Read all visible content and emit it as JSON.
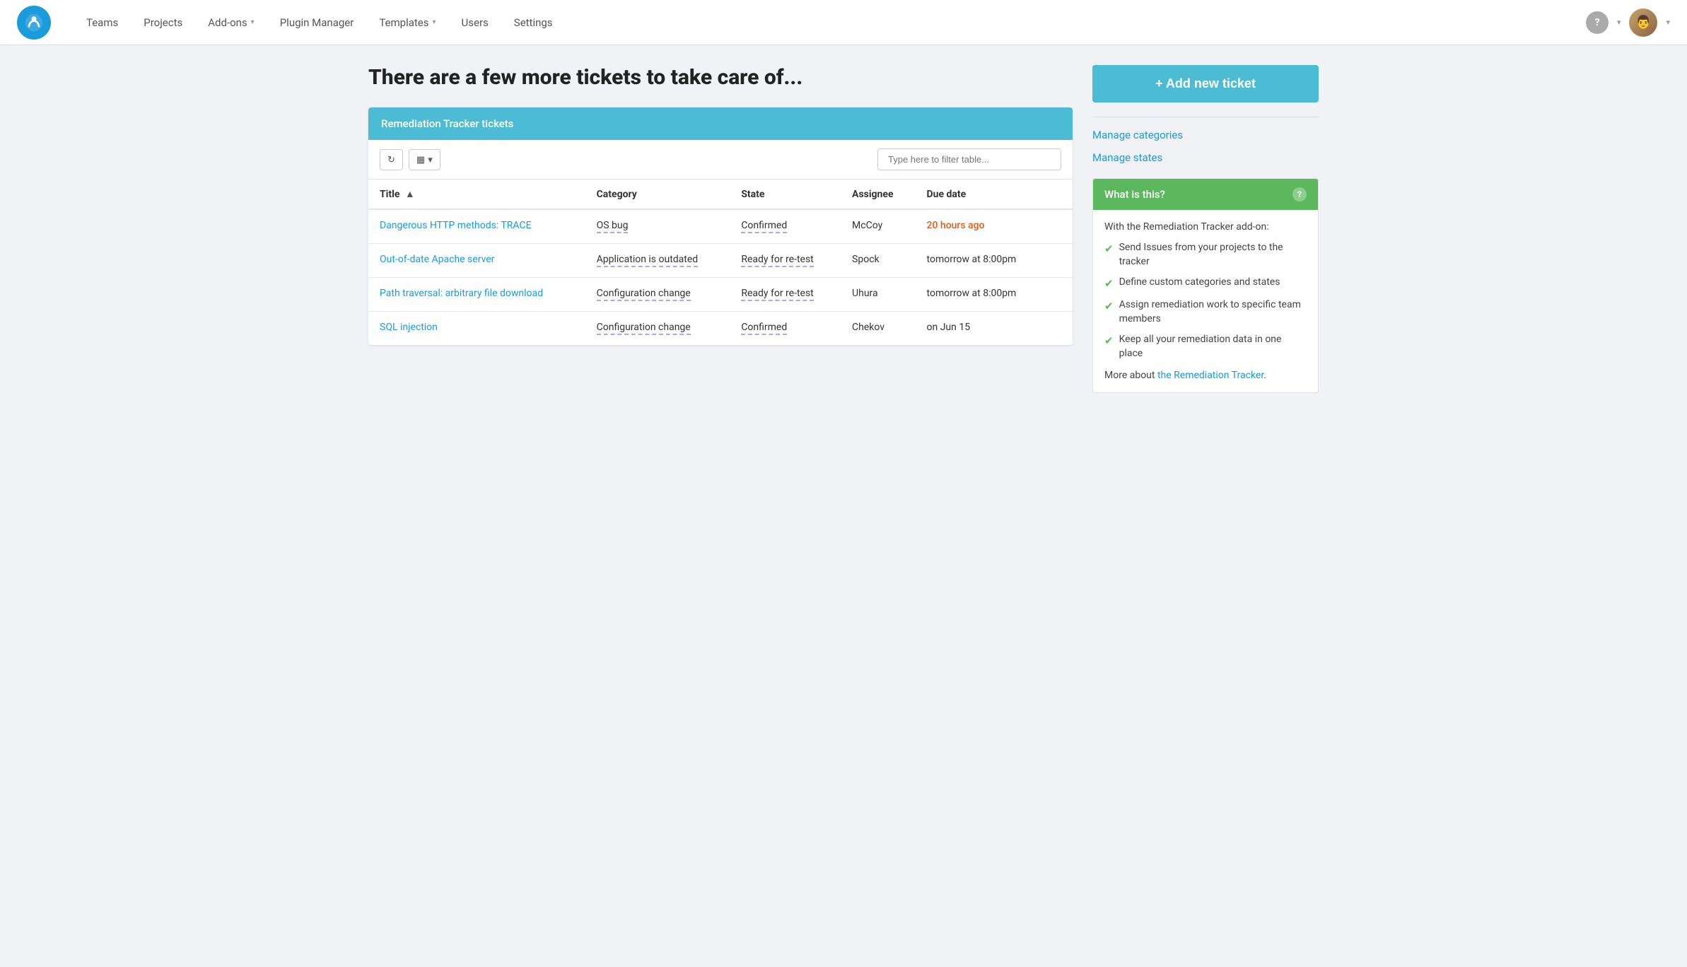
{
  "nav": {
    "links": [
      {
        "label": "Teams",
        "hasDropdown": false
      },
      {
        "label": "Projects",
        "hasDropdown": false
      },
      {
        "label": "Add-ons",
        "hasDropdown": true
      },
      {
        "label": "Plugin Manager",
        "hasDropdown": false
      },
      {
        "label": "Templates",
        "hasDropdown": true
      },
      {
        "label": "Users",
        "hasDropdown": false
      },
      {
        "label": "Settings",
        "hasDropdown": false
      }
    ],
    "helpLabel": "?",
    "avatarEmoji": "👨"
  },
  "page": {
    "title": "There are a few more tickets to take care of..."
  },
  "table": {
    "sectionTitle": "Remediation Tracker tickets",
    "filterPlaceholder": "Type here to filter table...",
    "columns": [
      "Title",
      "Category",
      "State",
      "Assignee",
      "Due date"
    ],
    "rows": [
      {
        "title": "Dangerous HTTP methods: TRACE",
        "category": "OS bug",
        "state": "Confirmed",
        "assignee": "McCoy",
        "dueDate": "20 hours ago",
        "dueDateOverdue": true
      },
      {
        "title": "Out-of-date Apache server",
        "category": "Application is outdated",
        "state": "Ready for re-test",
        "assignee": "Spock",
        "dueDate": "tomorrow at 8:00pm",
        "dueDateOverdue": false
      },
      {
        "title": "Path traversal: arbitrary file download",
        "category": "Configuration change",
        "state": "Ready for re-test",
        "assignee": "Uhura",
        "dueDate": "tomorrow at 8:00pm",
        "dueDateOverdue": false
      },
      {
        "title": "SQL injection",
        "category": "Configuration change",
        "state": "Confirmed",
        "assignee": "Chekov",
        "dueDate": "on Jun 15",
        "dueDateOverdue": false
      }
    ]
  },
  "sidebar": {
    "addTicketLabel": "+ Add new ticket",
    "manageCategoriesLabel": "Manage categories",
    "manageStatesLabel": "Manage states",
    "whatIsThis": {
      "headerLabel": "What is this?",
      "helpIcon": "?",
      "intro": "With the Remediation Tracker add-on:",
      "features": [
        "Send Issues from your projects to the tracker",
        "Define custom categories and states",
        "Assign remediation work to specific team members",
        "Keep all your remediation data in one place"
      ],
      "footerText": "More about ",
      "footerLinkLabel": "the Remediation Tracker",
      "footerSuffix": "."
    }
  }
}
